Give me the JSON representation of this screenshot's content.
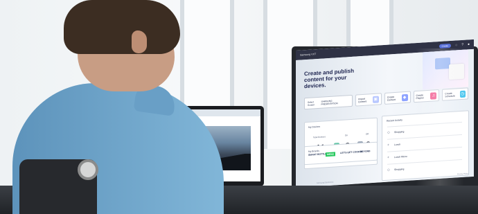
{
  "scene": {
    "description_colors": {
      "wall": "#eef2f4",
      "shirt": "#79aed1",
      "monitor": "#24272c",
      "accent": "#5a71da"
    }
  },
  "monitor_ui": {
    "topbar": {
      "brand": "Samsung VXT",
      "pill": "Create",
      "bell_icon": "bell-icon",
      "help_icon": "help-icon",
      "user_icon": "user-icon"
    },
    "hero": {
      "title_line_1": "Create and publish",
      "title_line_2": "content for your devices."
    },
    "quick_actions": {
      "select_label": "Select Screen",
      "select_value": "SAMSUNG PRESENTATION",
      "actions": [
        {
          "label": "Import Content",
          "icon": "import-icon",
          "color": "#b8c7ff"
        },
        {
          "label": "Create Content",
          "icon": "content-icon",
          "color": "#8ea3ff"
        },
        {
          "label": "Create Playlist",
          "icon": "playlist-icon",
          "color": "#f36c9b"
        },
        {
          "label": "Create Schedule",
          "icon": "schedule-icon",
          "color": "#4ec7ef"
        }
      ]
    },
    "devices": {
      "title": "My Devices",
      "metrics": [
        {
          "label": "Total Devices",
          "value": "11"
        },
        {
          "label": "On",
          "value": "2"
        },
        {
          "label": "Off",
          "value": "9"
        }
      ]
    },
    "brands": {
      "title": "My Brands",
      "items": [
        "SMART BOTTLE",
        "MENU",
        "LET'S GET COOKIN",
        "BEYOND"
      ]
    },
    "recent": {
      "title": "Recent Activity",
      "items": [
        {
          "label": "Shopping",
          "icon": "tag-icon"
        },
        {
          "label": "Lunch",
          "icon": "plus-icon"
        },
        {
          "label": "Lunch Menu",
          "icon": "plus-icon"
        },
        {
          "label": "Shopping",
          "icon": "tag-icon"
        }
      ]
    },
    "footer": {
      "left": "Samsung Electronics",
      "right": "Privacy Policy"
    }
  }
}
